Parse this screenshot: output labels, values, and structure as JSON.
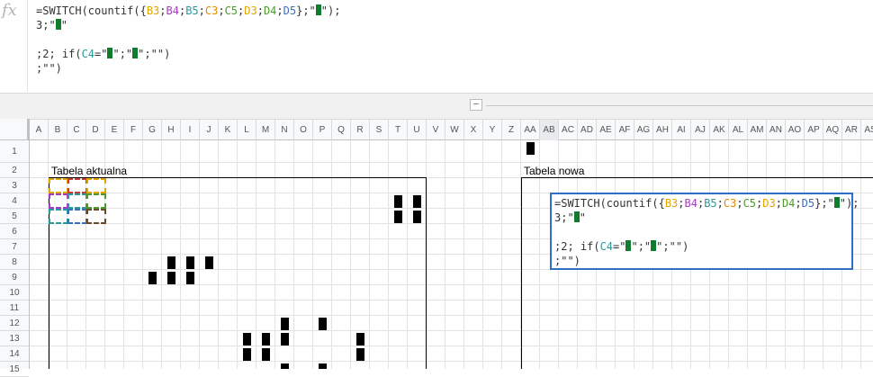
{
  "formula_bar": {
    "icon": "fx",
    "lines": [
      [
        "=SWITCH(countif({",
        "B3",
        ";",
        "B4",
        ";",
        "B5",
        ";",
        "C3",
        ";",
        "C5",
        ";",
        "D3",
        ";",
        "D4",
        ";",
        "D5",
        "};\"",
        "BLOCK",
        "\");"
      ],
      [
        "3;\"",
        "BLOCK",
        "\""
      ],
      [
        ""
      ],
      [
        ";2; if(",
        "C4",
        "=\"",
        "BLOCK",
        "\";\"",
        "BLOCK",
        "\";\"\")"
      ],
      [
        ";\"\")"
      ]
    ]
  },
  "collapse_button": "−",
  "columns": [
    "A",
    "B",
    "C",
    "D",
    "E",
    "F",
    "G",
    "H",
    "I",
    "J",
    "K",
    "L",
    "M",
    "N",
    "O",
    "P",
    "Q",
    "R",
    "S",
    "T",
    "U",
    "V",
    "W",
    "X",
    "Y",
    "Z",
    "AA",
    "AB",
    "AC",
    "AD",
    "AE",
    "AF",
    "AG",
    "AH",
    "AI",
    "AJ",
    "AK",
    "AL",
    "AM",
    "AN",
    "AO",
    "AP",
    "AQ",
    "AR",
    "AS"
  ],
  "rows": [
    "1",
    "2",
    "3",
    "4",
    "5",
    "6",
    "7",
    "8",
    "9",
    "10",
    "11",
    "12",
    "13",
    "14",
    "15"
  ],
  "labels": {
    "current_table": "Tabela aktualna",
    "new_table": "Tabela nowa"
  },
  "colors": {
    "accent": "#2f6fc6",
    "block_green": "#0f7d2d",
    "ref_yellow": "#e3a600",
    "ref_purple": "#a43dc0",
    "ref_teal": "#2b9a9a",
    "ref_orange": "#e38b00",
    "ref_green": "#4d9a2a",
    "ref_blue": "#3a6ec0"
  }
}
